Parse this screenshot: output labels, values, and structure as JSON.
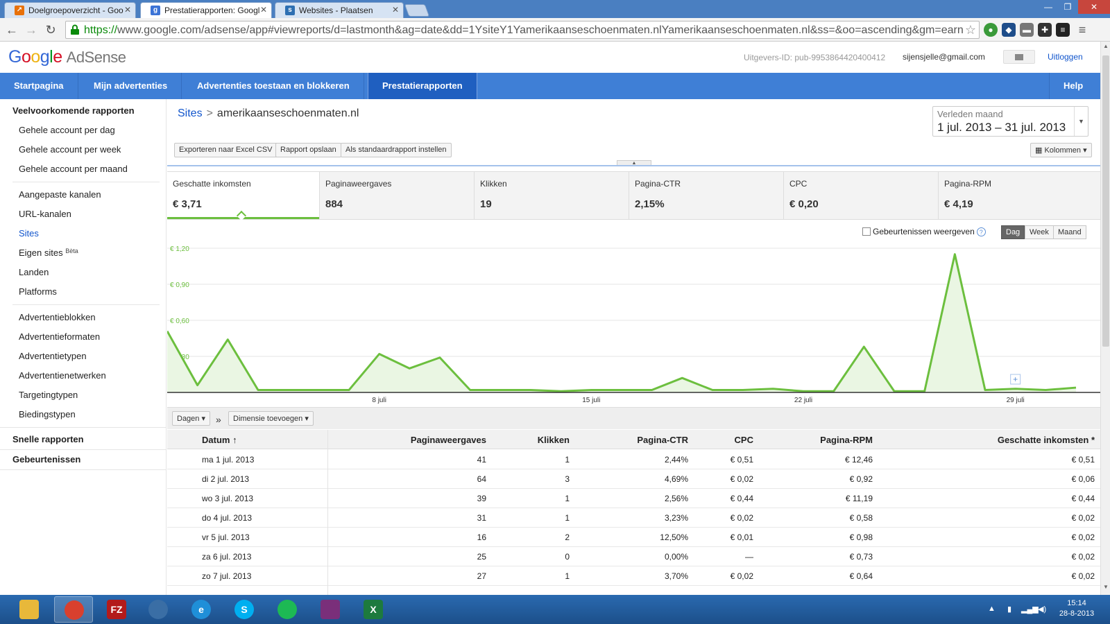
{
  "browser": {
    "tabs": [
      {
        "title": "Doelgroepoverzicht - Goo",
        "fav_color": "#e8710a",
        "active": false
      },
      {
        "title": "Prestatierapporten: Googl",
        "fav_color": "#3b73d6",
        "active": true
      },
      {
        "title": "Websites - Plaatsen",
        "fav_color": "#2d6fb2",
        "active": false
      }
    ],
    "url_scheme": "https://",
    "url_rest": "www.google.com/adsense/app#viewreports/d=lastmonth&ag=date&dd=1YsiteY1Yamerikaanseschoenmaten.nlYamerikaanseschoenmaten.nl&ss=&oo=ascending&gm=earn"
  },
  "header": {
    "logo_letters": [
      "G",
      "o",
      "o",
      "g",
      "l",
      "e"
    ],
    "product": "AdSense",
    "publisher_id": "Uitgevers-ID: pub-9953864420400412",
    "email": "sijensjelle@gmail.com",
    "logout": "Uitloggen"
  },
  "nav": {
    "items": [
      "Startpagina",
      "Mijn advertenties",
      "Advertenties toestaan en blokkeren",
      "Prestatierapporten"
    ],
    "help": "Help"
  },
  "sidebar": {
    "heading_common": "Veelvoorkomende rapporten",
    "group1": [
      "Gehele account per dag",
      "Gehele account per week",
      "Gehele account per maand"
    ],
    "group2": [
      "Aangepaste kanalen",
      "URL-kanalen",
      "Sites",
      "Eigen sites",
      "Landen",
      "Platforms"
    ],
    "beta": "Bèta",
    "group3": [
      "Advertentieblokken",
      "Advertentieformaten",
      "Advertentietypen",
      "Advertentienetwerken",
      "Targetingtypen",
      "Biedingstypen"
    ],
    "heading_quick": "Snelle rapporten",
    "heading_events": "Gebeurtenissen"
  },
  "report": {
    "breadcrumb_root": "Sites",
    "breadcrumb_sep": ">",
    "breadcrumb_site": "amerikaanseschoenmaten.nl",
    "date_label": "Verleden maand",
    "date_value": "1 jul. 2013 – 31 jul. 2013",
    "buttons": {
      "export": "Exporteren naar Excel CSV",
      "save": "Rapport opslaan",
      "default": "Als standaardrapport instellen",
      "columns": "Kolommen"
    },
    "metrics": [
      {
        "label": "Geschatte inkomsten",
        "value": "€ 3,71"
      },
      {
        "label": "Paginaweergaves",
        "value": "884"
      },
      {
        "label": "Klikken",
        "value": "19"
      },
      {
        "label": "Pagina-CTR",
        "value": "2,15%"
      },
      {
        "label": "CPC",
        "value": "€ 0,20"
      },
      {
        "label": "Pagina-RPM",
        "value": "€ 4,19"
      }
    ],
    "events_label": "Gebeurtenissen weergeven",
    "granularity": [
      "Dag",
      "Week",
      "Maand"
    ],
    "dims_btn": "Dagen",
    "add_dim_btn": "Dimensie toevoegen",
    "raquo": "»"
  },
  "chart_data": {
    "type": "area",
    "x": [
      1,
      2,
      3,
      4,
      5,
      6,
      7,
      8,
      9,
      10,
      11,
      12,
      13,
      14,
      15,
      16,
      17,
      18,
      19,
      20,
      21,
      22,
      23,
      24,
      25,
      26,
      27,
      28,
      29,
      30,
      31
    ],
    "series": [
      {
        "values": [
          0.51,
          0.06,
          0.44,
          0.02,
          0.02,
          0.02,
          0.02,
          0.32,
          0.2,
          0.29,
          0.02,
          0.02,
          0.02,
          0.01,
          0.02,
          0.02,
          0.02,
          0.12,
          0.02,
          0.02,
          0.03,
          0.01,
          0.01,
          0.38,
          0.01,
          0.01,
          1.15,
          0.02,
          0.03,
          0.02,
          0.04
        ]
      }
    ],
    "yticks": [
      "€ 1,20",
      "€ 0,90",
      "€ 0,60",
      "€ 0,30"
    ],
    "ytick_values": [
      1.2,
      0.9,
      0.6,
      0.3
    ],
    "xticks": [
      {
        "day": 8,
        "label": "8 juli"
      },
      {
        "day": 15,
        "label": "15 juli"
      },
      {
        "day": 22,
        "label": "22 juli"
      },
      {
        "day": 29,
        "label": "29 juli"
      }
    ],
    "ylim": [
      0,
      1.2
    ],
    "color": "#6cbf3e",
    "fill": "#eaf6e3",
    "grid": true
  },
  "table": {
    "headers": [
      "Datum",
      "Paginaweergaves",
      "Klikken",
      "Pagina-CTR",
      "CPC",
      "Pagina-RPM",
      "Geschatte inkomsten *"
    ],
    "sort_arrow": "↑",
    "rows": [
      [
        "ma 1 jul. 2013",
        "41",
        "1",
        "2,44%",
        "€ 0,51",
        "€ 12,46",
        "€ 0,51"
      ],
      [
        "di 2 jul. 2013",
        "64",
        "3",
        "4,69%",
        "€ 0,02",
        "€ 0,92",
        "€ 0,06"
      ],
      [
        "wo 3 jul. 2013",
        "39",
        "1",
        "2,56%",
        "€ 0,44",
        "€ 11,19",
        "€ 0,44"
      ],
      [
        "do 4 jul. 2013",
        "31",
        "1",
        "3,23%",
        "€ 0,02",
        "€ 0,58",
        "€ 0,02"
      ],
      [
        "vr 5 jul. 2013",
        "16",
        "2",
        "12,50%",
        "€ 0,01",
        "€ 0,98",
        "€ 0,02"
      ],
      [
        "za 6 jul. 2013",
        "25",
        "0",
        "0,00%",
        "—",
        "€ 0,73",
        "€ 0,02"
      ],
      [
        "zo 7 jul. 2013",
        "27",
        "1",
        "3,70%",
        "€ 0,02",
        "€ 0,64",
        "€ 0,02"
      ]
    ]
  },
  "taskbar": {
    "apps": [
      {
        "name": "explorer",
        "color": "#e8b83a",
        "glyph": ""
      },
      {
        "name": "chrome",
        "color": "#d9402e",
        "glyph": ""
      },
      {
        "name": "filezilla",
        "color": "#b31b1b",
        "glyph": "FZ"
      },
      {
        "name": "thunderbird",
        "color": "#3a6ea5",
        "glyph": ""
      },
      {
        "name": "ie",
        "color": "#1f8fd8",
        "glyph": "e"
      },
      {
        "name": "skype",
        "color": "#00aff0",
        "glyph": "S"
      },
      {
        "name": "spotify",
        "color": "#1db954",
        "glyph": ""
      },
      {
        "name": "winrar",
        "color": "#7a2f7a",
        "glyph": ""
      },
      {
        "name": "excel",
        "color": "#1d7a3e",
        "glyph": "X"
      }
    ],
    "time": "15:14",
    "date": "28-8-2013"
  }
}
